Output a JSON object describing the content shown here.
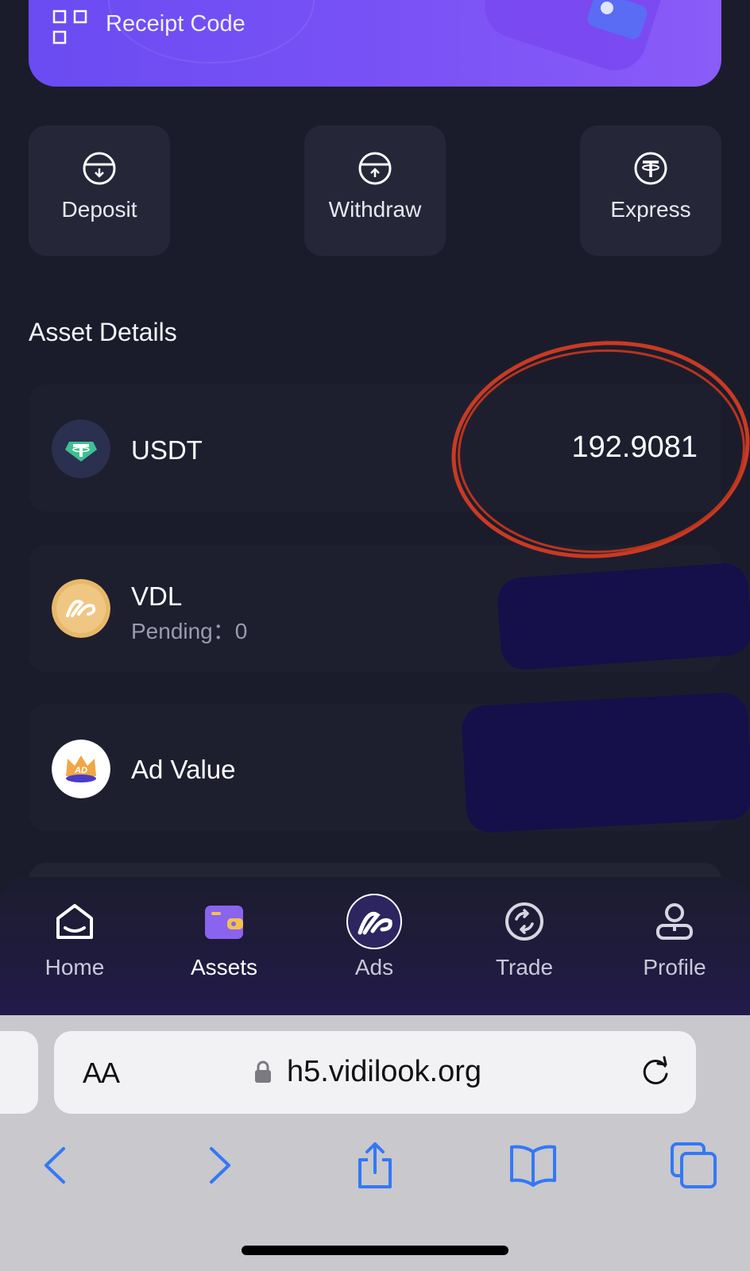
{
  "receipt": {
    "label": "Receipt Code",
    "icon": "qr-grid-icon"
  },
  "actions": [
    {
      "label": "Deposit",
      "icon": "deposit-icon"
    },
    {
      "label": "Withdraw",
      "icon": "withdraw-icon"
    },
    {
      "label": "Express",
      "icon": "tether-icon"
    }
  ],
  "section_title": "Asset Details",
  "assets": [
    {
      "name": "USDT",
      "value": "192.9081",
      "logo": "usdt-logo"
    },
    {
      "name": "VDL",
      "sub": "Pending：0",
      "logo": "vdl-logo"
    },
    {
      "name": "Ad Value",
      "logo": "ad-crown-logo"
    }
  ],
  "tabbar": {
    "items": [
      {
        "label": "Home",
        "icon": "home-icon"
      },
      {
        "label": "Assets",
        "icon": "wallet-icon"
      },
      {
        "label": "Ads",
        "icon": "ads-logo-icon"
      },
      {
        "label": "Trade",
        "icon": "exchange-icon"
      },
      {
        "label": "Profile",
        "icon": "profile-icon"
      }
    ],
    "active": "Assets"
  },
  "browser": {
    "text_size_label": "AA",
    "url": "h5.vidilook.org"
  },
  "colors": {
    "background": "#1b1c2b",
    "banner": "#7a52f6",
    "annotation_circle": "#c93a23",
    "redaction": "#150f4a",
    "ios_blue": "#3478f6"
  }
}
